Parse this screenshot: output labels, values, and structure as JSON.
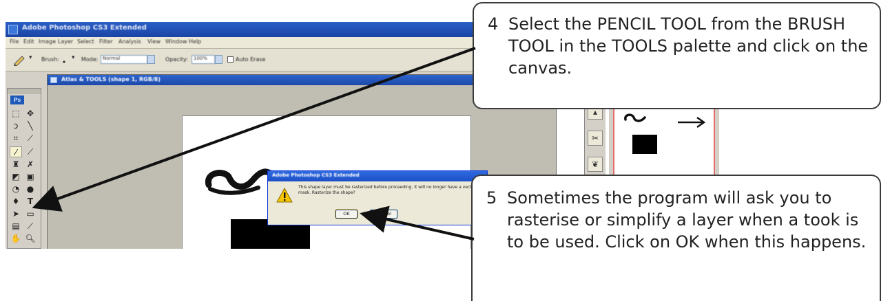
{
  "window": {
    "title": "Adobe Photoshop CS3 Extended",
    "menu": [
      "File",
      "Edit",
      "Image",
      "Layer",
      "Select",
      "Filter",
      "Analysis",
      "View",
      "Window",
      "Help"
    ]
  },
  "options_bar": {
    "brush_label": "Brush:",
    "mode_label": "Mode:",
    "mode_value": "Normal",
    "opacity_label": "Opacity:",
    "opacity_value": "100%",
    "auto_erase_label": "Auto Erase"
  },
  "tools_palette": {
    "logo": "Ps"
  },
  "document": {
    "title": "Atlas & TOOLS (shape 1, RGB/8)"
  },
  "dialog": {
    "title": "Adobe Photoshop CS3 Extended",
    "message": "This shape layer must be rasterized before proceeding. It will no longer have a vector mask. Rasterize the shape?",
    "ok_label": "OK",
    "cancel_label": "Cancel"
  },
  "callouts": [
    {
      "number": "4",
      "text": "Select the PENCIL TOOL from the BRUSH TOOL in the TOOLS palette and click on the canvas."
    },
    {
      "number": "5",
      "text": "Sometimes the program will ask you to rasterise or simplify a layer when a took is to be used.  Click on OK when this happens."
    }
  ],
  "icons": {
    "title_icon": "photoshop-app-icon",
    "warning": "warning-triangle-icon",
    "pencil_tool": "pencil-icon",
    "brush_preset": "brush-icon",
    "navigator_arrow": "right-arrow-icon",
    "annotation_arrows": "arrow-icon"
  },
  "colors": {
    "titlebar": "#1f4fb4",
    "dialog_border": "#0831d9",
    "callout_border": "#3a3a3a",
    "warning": "#f5c400",
    "navigator_border": "#e36b6b"
  }
}
